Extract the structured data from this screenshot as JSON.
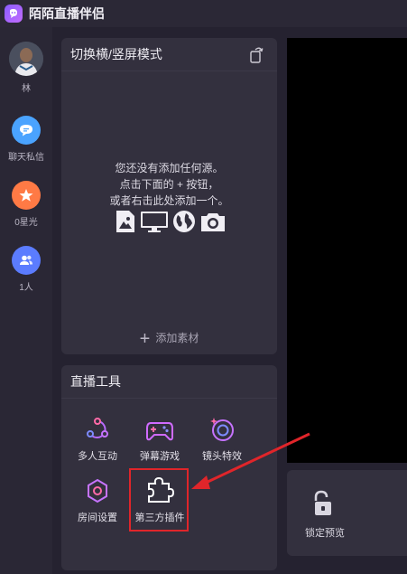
{
  "app": {
    "title": "陌陌直播伴侣"
  },
  "sidebar": {
    "user_name": "林",
    "items": [
      {
        "label": "聊天私信",
        "icon": "chat-bubble-icon",
        "color": "#4aa3ff"
      },
      {
        "label": "0星光",
        "icon": "star-icon",
        "color": "#ff7a45"
      },
      {
        "label": "1人",
        "icon": "people-icon",
        "color": "#5b7cff"
      }
    ]
  },
  "scene_panel": {
    "title": "切换横/竖屏模式",
    "empty_line1": "您还没有添加任何源。",
    "empty_line2": "点击下面的 + 按钮，",
    "empty_line3": "或者右击此处添加一个。",
    "add_material": "添加素材"
  },
  "tools_panel": {
    "title": "直播工具",
    "tools": [
      {
        "label": "多人互动",
        "icon": "multi-interaction-icon"
      },
      {
        "label": "弹幕游戏",
        "icon": "gamepad-icon"
      },
      {
        "label": "镜头特效",
        "icon": "camera-effect-icon"
      },
      {
        "label": "房间设置",
        "icon": "room-settings-icon"
      },
      {
        "label": "第三方插件",
        "icon": "puzzle-plugin-icon"
      }
    ]
  },
  "preview": {
    "lock_label": "锁定预览"
  },
  "colors": {
    "accent": "#8a5cff",
    "annotation": "#e0252a"
  }
}
